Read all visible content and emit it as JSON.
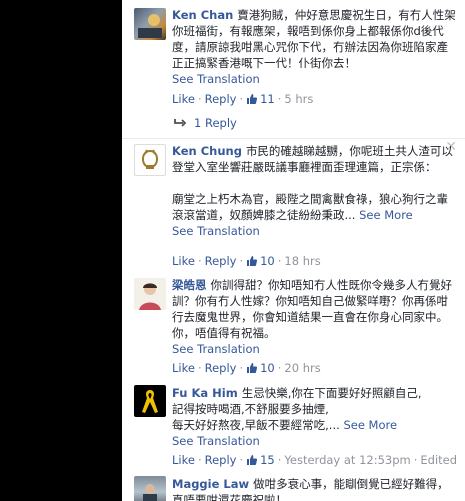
{
  "ui": {
    "like": "Like",
    "reply": "Reply",
    "dot": "·",
    "see_translation": "See Translation",
    "see_more": "See More"
  },
  "comments": [
    {
      "author": "Ken Chan",
      "text": "賣港狗賊，仲好意思慶祝生日，有冇人性架你班福街，有報應架，報唔到係你身上都報係你d後代度，請原諒我咁黑心咒你下代，冇辦法因為你班陷家產正正搞緊香港嘅下一代！仆街你去！",
      "likes": "11",
      "time": "5 hrs",
      "replies": "1 Reply"
    },
    {
      "author": "Ken Chung",
      "text": "市民的確越睇越嬲，你呢班土共人渣可以登堂入室坐響莊嚴既議事廳裡面歪理連篇，正宗係：",
      "text2": "廟堂之上朽木為官，殿陛之間禽獸食祿，狼心狗行之輩滾滾當道，奴顏婢膝之徒紛紛秉政...",
      "likes": "10",
      "time": "18 hrs"
    },
    {
      "author": "梁皓恩",
      "text": "你訓得甜？你知唔知冇人性既你令幾多人冇覺好訓？你有冇人性嫁？你知唔知自己做緊咩嘢？你再係咁行去魔鬼世界，你會知道結果一直會在你身心同家中。你，唔值得有祝福。",
      "likes": "10",
      "time": "20 hrs"
    },
    {
      "author": "Fu Ka Him",
      "line1": "生忌快樂,你在下面要好好照顧自己,",
      "line2": "記得按時喝酒,不舒服要多抽煙,",
      "line3": "每天好好熬夜,早飯不要經常吃,...",
      "likes": "15",
      "time": "Yesterday at 12:53pm",
      "edited": "Edited"
    },
    {
      "author": "Maggie Law",
      "text": "做咁多衰心事，能瞓倒覺已經好難得，真唔要咁還花慶祝啦！"
    }
  ],
  "colors": {
    "link": "#365899",
    "text": "#1d2129",
    "meta": "#90949c"
  },
  "icons": [
    "thumbs-up-icon",
    "reply-arrow-icon",
    "close-icon"
  ]
}
